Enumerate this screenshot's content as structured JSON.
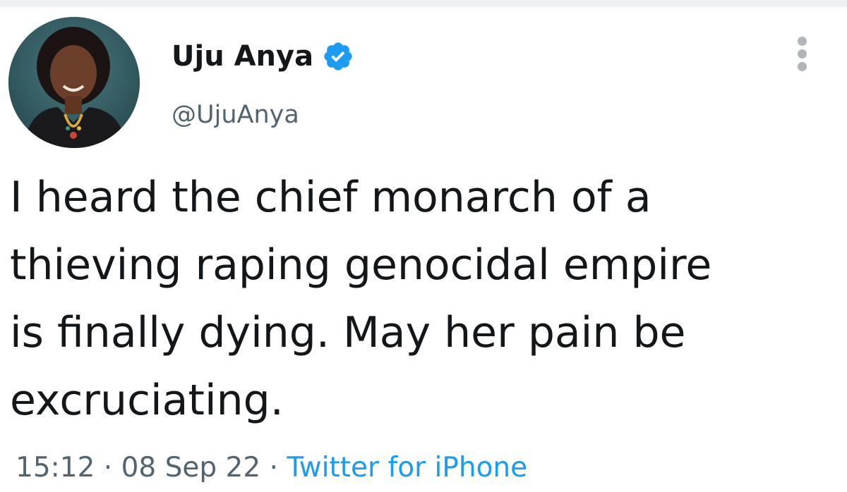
{
  "author": {
    "display_name": "Uju Anya",
    "handle": "@UjuAnya",
    "verified": true
  },
  "tweet": {
    "text": "I heard the chief monarch of a\nthieving raping genocidal empire\nis finally dying. May her pain be\nexcruciating."
  },
  "meta": {
    "time": "15:12",
    "separator": " · ",
    "date": "08 Sep 22",
    "source": "Twitter for iPhone"
  },
  "icons": {
    "verified": "verified-badge-icon",
    "more": "more-vertical-icon"
  },
  "colors": {
    "accent": "#1d9bf0",
    "text": "#14171a",
    "secondary_text": "#536471",
    "background": "#ffffff"
  }
}
